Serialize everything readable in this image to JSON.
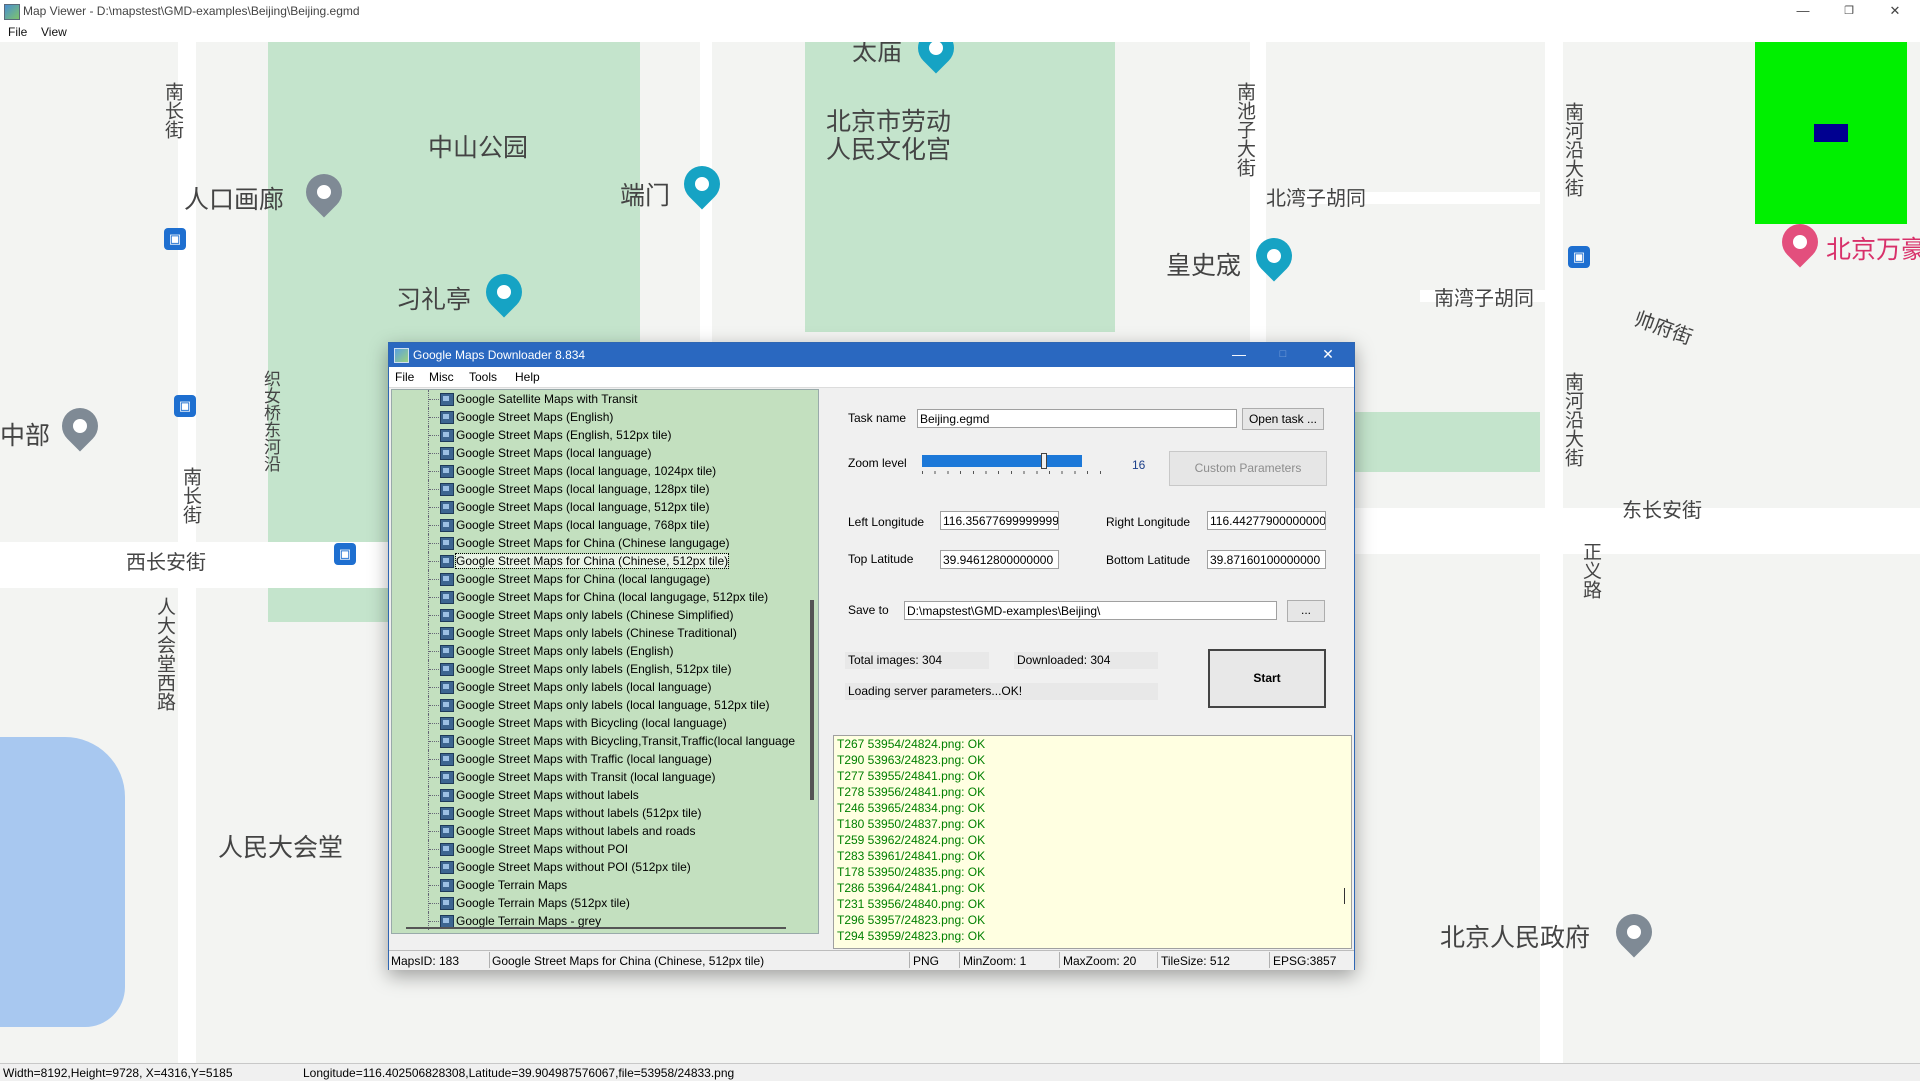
{
  "viewer": {
    "title": "Map Viewer - D:\\mapstest\\GMD-examples\\Beijing\\Beijing.egmd",
    "menu": [
      "File",
      "View"
    ],
    "status_left": "Width=8192,Height=9728, X=4316,Y=5185",
    "status_right": "Longitude=116.402506828308,Latitude=39.904987576067,file=53958/24833.png"
  },
  "map_labels": {
    "zhongshan_park": "中山公园",
    "labor_palace_1": "北京市劳动",
    "labor_palace_2": "人民文化宫",
    "duanmen": "端门",
    "renkou": "人口画廊",
    "xili": "习礼亭",
    "huangshicheng": "皇史宬",
    "beiwan": "北湾子胡同",
    "nanwan": "南湾子胡同",
    "zhongbu": "中部",
    "xichangan": "西长安街",
    "dongchangan": "东长安街",
    "renmin_hall": "人民大会堂",
    "beijing_gov": "北京人民政府",
    "beijing_hotel": "北京万豪",
    "nanchang": "南长街",
    "nanchizi": "南池子大街",
    "nanheyan": "南河沿大街",
    "zhengyi": "正义路",
    "rendahui_west": "人大会堂西路",
    "taimiao": "太庙",
    "shuaifu": "帅府街",
    "zhinv": "织女桥东河沿",
    "nanchang2": "南长街",
    "nanheyan2": "南河沿大街"
  },
  "dialog": {
    "title": "Google Maps Downloader 8.834",
    "menu": [
      "File",
      "Misc",
      "Tools",
      "Help"
    ],
    "map_list": [
      "Google Satellite Maps with Transit",
      "Google Street Maps (English)",
      "Google Street Maps (English, 512px tile)",
      "Google Street Maps (local language)",
      "Google Street Maps (local language, 1024px tile)",
      "Google Street Maps (local language, 128px tile)",
      "Google Street Maps (local language, 512px tile)",
      "Google Street Maps (local language, 768px tile)",
      "Google Street Maps for China (Chinese langugage)",
      "Google Street Maps for China (Chinese, 512px tile)",
      "Google Street Maps for China (local langugage)",
      "Google Street Maps for China (local langugage, 512px tile)",
      "Google Street Maps only labels (Chinese Simplified)",
      "Google Street Maps only labels (Chinese Traditional)",
      "Google Street Maps only labels (English)",
      "Google Street Maps only labels (English, 512px tile)",
      "Google Street Maps only labels (local language)",
      "Google Street Maps only labels (local language, 512px tile)",
      "Google Street Maps with Bicycling (local language)",
      "Google Street Maps with Bicycling,Transit,Traffic(local language",
      "Google Street Maps with Traffic (local language)",
      "Google Street Maps with Transit (local language)",
      "Google Street Maps without labels",
      "Google Street Maps without labels (512px tile)",
      "Google Street Maps without labels and roads",
      "Google Street Maps without POI",
      "Google Street Maps without POI (512px tile)",
      "Google Terrain Maps",
      "Google Terrain Maps (512px tile)",
      "Google Terrain Maps - grey"
    ],
    "selected_index": 9,
    "task_name_label": "Task name",
    "task_name_value": "Beijing.egmd",
    "open_task_label": "Open task ...",
    "zoom_label": "Zoom level",
    "zoom_value": "16",
    "zoom_level": 16,
    "zoom_max": 20,
    "custom_params_label": "Custom Parameters",
    "left_lon_label": "Left Longitude",
    "left_lon_value": "116.35677699999999",
    "right_lon_label": "Right Longitude",
    "right_lon_value": "116.44277900000000",
    "top_lat_label": "Top Latitude",
    "top_lat_value": "39.94612800000000",
    "bottom_lat_label": "Bottom Latitude",
    "bottom_lat_value": "39.87160100000000",
    "save_to_label": "Save to",
    "save_to_value": "D:\\mapstest\\GMD-examples\\Beijing\\",
    "browse_label": "...",
    "total_images": "Total images: 304",
    "downloaded": "Downloaded: 304",
    "loading_status": "Loading server parameters...OK!",
    "start_label": "Start",
    "log": [
      "T267 53954/24824.png: OK",
      "T290 53963/24823.png: OK",
      "T277 53955/24841.png: OK",
      "T278 53956/24841.png: OK",
      "T246 53965/24834.png: OK",
      "T180 53950/24837.png: OK",
      "T259 53962/24824.png: OK",
      "T283 53961/24841.png: OK",
      "T178 53950/24835.png: OK",
      "T286 53964/24841.png: OK",
      "T231 53956/24840.png: OK",
      "T296 53957/24823.png: OK",
      "T294 53959/24823.png: OK"
    ],
    "status": {
      "maps_id": "MapsID: 183",
      "map_name": "Google Street Maps for China (Chinese, 512px tile)",
      "format": "PNG",
      "min_zoom": "MinZoom: 1",
      "max_zoom": "MaxZoom: 20",
      "tile_size": "TileSize: 512",
      "epsg": "EPSG:3857"
    }
  },
  "colors": {
    "park": "#c4e4cc",
    "dialog_title": "#2a68c0",
    "list_bg": "#c3e0bf",
    "log_bg": "#ffffe1",
    "log_text": "#008000",
    "minimap": "#00f000"
  }
}
